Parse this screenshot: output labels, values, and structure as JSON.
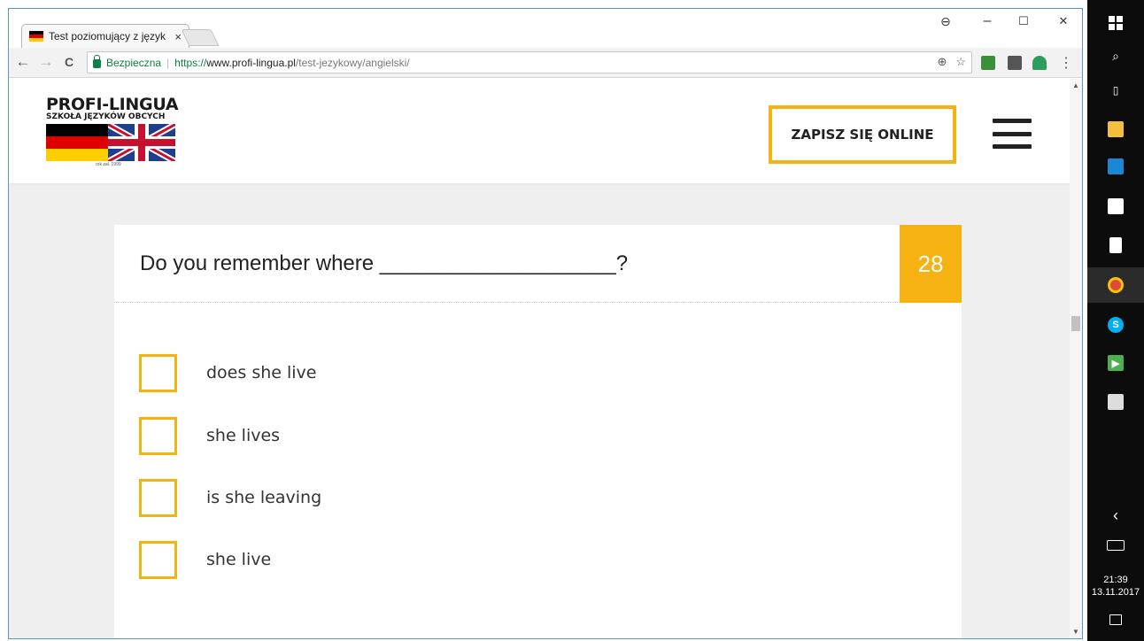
{
  "browser": {
    "tab_title": "Test poziomujący z język",
    "tab_close": "×",
    "window_controls": {
      "account": "⊖",
      "minimize": "–",
      "maximize": "☐",
      "close": "✕"
    },
    "nav": {
      "back": "←",
      "forward": "→",
      "reload": "C"
    },
    "address": {
      "secure_label": "Bezpieczna",
      "protocol": "https://",
      "host": "www.profi-lingua.pl",
      "path": "/test-jezykowy/angielski/"
    },
    "omnibox_icons": [
      "zoom-icon",
      "star-icon"
    ],
    "extensions": [
      "ext-green-icon",
      "ext-download-icon",
      "ext-new-icon"
    ]
  },
  "site": {
    "logo": {
      "name": "PROFI-LINGUA",
      "subtitle": "SZKOŁA JĘZYKÓW OBCYCH",
      "since": "rok zał. 1999"
    },
    "cta_label": "ZAPISZ SIĘ ONLINE",
    "menu_icon": "hamburger-menu-icon"
  },
  "quiz": {
    "question": "Do you remember where ____________________?",
    "number": "28",
    "options": [
      "does she live",
      "she lives",
      "is she leaving",
      "she live"
    ]
  },
  "taskbar": {
    "time": "21:39",
    "date": "13.11.2017",
    "collapse": "‹"
  },
  "colors": {
    "accent": "#f6b113",
    "secure": "#0b8043"
  }
}
